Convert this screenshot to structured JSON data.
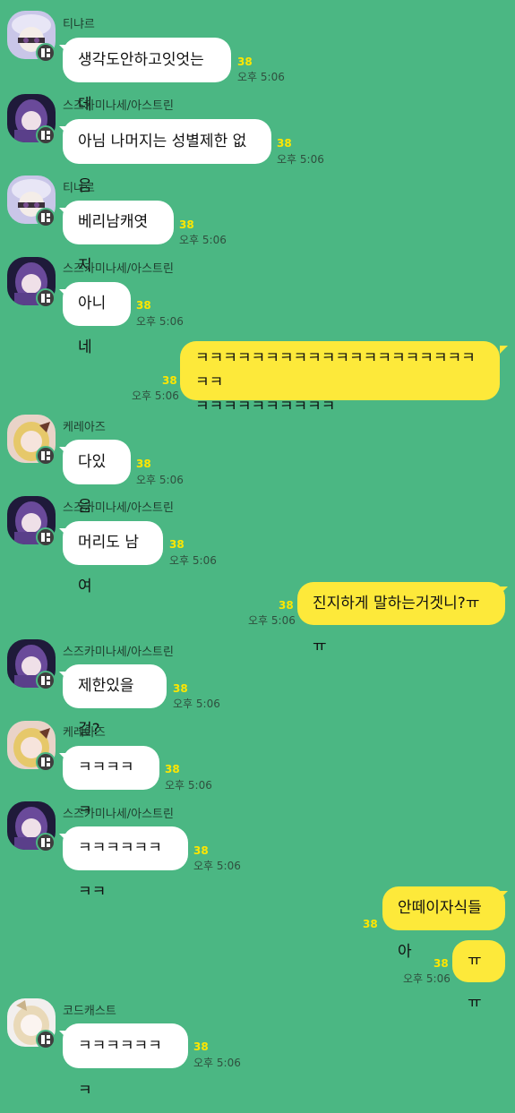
{
  "colors": {
    "background": "#4bb783",
    "bubble_incoming": "#ffffff",
    "bubble_outgoing": "#fde93a",
    "unread_count": "#ffe600"
  },
  "messages": [
    {
      "sender": "티냐르",
      "text": "생각도안하고잇엇는데",
      "count": "38",
      "time": "오후 5:06",
      "avatar_icon": "avatar-white-hat-girl"
    },
    {
      "sender": "스즈카미나세/아스트린",
      "text": "아님 나머지는 성별제한 없음",
      "count": "38",
      "time": "오후 5:06",
      "avatar_icon": "avatar-purple-hair-girl"
    },
    {
      "sender": "티냐르",
      "text": "베리남캐엿지",
      "count": "38",
      "time": "오후 5:06",
      "avatar_icon": "avatar-white-hat-girl"
    },
    {
      "sender": "스즈카미나세/아스트린",
      "text": "아니네",
      "count": "38",
      "time": "오후 5:06",
      "avatar_icon": "avatar-purple-hair-girl"
    },
    {
      "sender": "",
      "text": "ㅋㅋㅋㅋㅋㅋㅋㅋㅋㅋㅋㅋㅋㅋㅋㅋㅋㅋㅋㅋㅋㅋ\nㅋㅋㅋㅋㅋㅋㅋㅋㅋㅋ",
      "count": "38",
      "time": "오후 5:06"
    },
    {
      "sender": "케레아즈",
      "text": "다있음",
      "count": "38",
      "time": "오후 5:06",
      "avatar_icon": "avatar-blonde-girl"
    },
    {
      "sender": "스즈카미나세/아스트린",
      "text": "머리도 남여",
      "count": "38",
      "time": "오후 5:06",
      "avatar_icon": "avatar-purple-hair-girl"
    },
    {
      "sender": "",
      "text": "진지하게 말하는거겟니?ㅠㅠ",
      "count": "38",
      "time": "오후 5:06"
    },
    {
      "sender": "스즈카미나세/아스트린",
      "text": "제한있을걸?",
      "count": "38",
      "time": "오후 5:06",
      "avatar_icon": "avatar-purple-hair-girl"
    },
    {
      "sender": "케레아즈",
      "text": "ㅋㅋㅋㅋㅋ",
      "count": "38",
      "time": "오후 5:06",
      "avatar_icon": "avatar-blonde-girl"
    },
    {
      "sender": "스즈카미나세/아스트린",
      "text": "ㅋㅋㅋㅋㅋㅋㅋㅋ",
      "count": "38",
      "time": "오후 5:06",
      "avatar_icon": "avatar-purple-hair-girl"
    },
    {
      "sender": "",
      "text": "안떼이자식들아",
      "count": "38",
      "time": ""
    },
    {
      "sender": "",
      "text": "ㅠㅠ",
      "count": "38",
      "time": "오후 5:06"
    },
    {
      "sender": "코드캐스트",
      "text": "ㅋㅋㅋㅋㅋㅋㅋ",
      "count": "38",
      "time": "오후 5:06",
      "avatar_icon": "avatar-pale-hair-girl"
    }
  ]
}
